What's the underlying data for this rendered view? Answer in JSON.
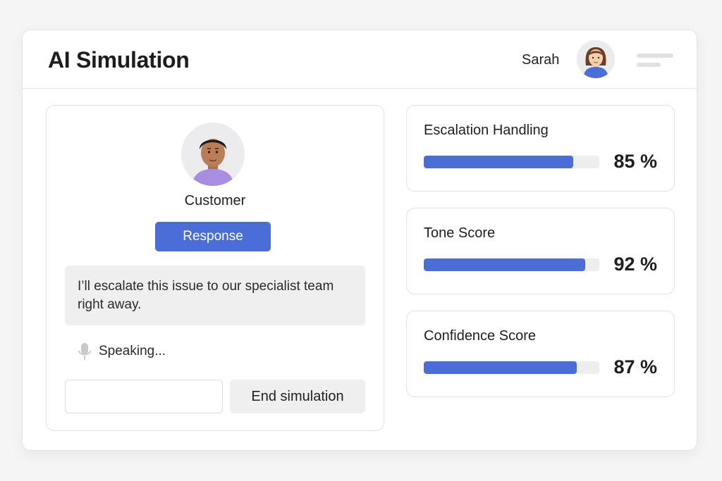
{
  "header": {
    "title": "AI Simulation",
    "user_name": "Sarah"
  },
  "conversation": {
    "role_label": "Customer",
    "response_button": "Response",
    "message": "I’ll escalate this issue to our specialist team right away.",
    "status": "Speaking...",
    "input_value": "",
    "input_placeholder": "",
    "end_button": "End simulation"
  },
  "metrics": [
    {
      "label": "Escalation Handling",
      "value": 85,
      "display": "85 %"
    },
    {
      "label": "Tone Score",
      "value": 92,
      "display": "92 %"
    },
    {
      "label": "Confidence Score",
      "value": 87,
      "display": "87 %"
    }
  ],
  "colors": {
    "accent": "#4a6ed6",
    "track": "#eeeeef"
  },
  "icons": {
    "user_avatar": "woman-avatar-icon",
    "customer_avatar": "man-avatar-icon",
    "menu": "menu-icon",
    "status": "microphone-icon"
  }
}
